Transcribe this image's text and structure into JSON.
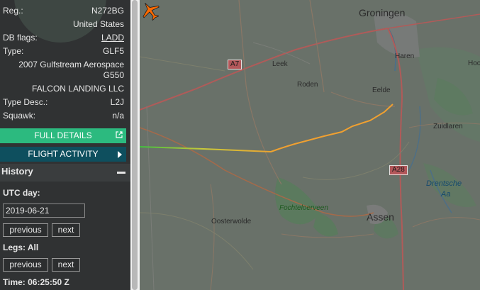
{
  "details": {
    "reg_label": "Reg.:",
    "reg_value": "N272BG",
    "country": "United States",
    "dbflags_label": "DB flags:",
    "dbflags_value": "LADD",
    "type_label": "Type:",
    "type_value": "GLF5",
    "model_line1": "2007 Gulfstream Aerospace",
    "model_line2": "G550",
    "owner": "FALCON LANDING LLC",
    "typedesc_label": "Type Desc.:",
    "typedesc_value": "L2J",
    "squawk_label": "Squawk:",
    "squawk_value": "n/a"
  },
  "buttons": {
    "full_details": "FULL DETAILS",
    "flight_activity": "FLIGHT ACTIVITY"
  },
  "history": {
    "title": "History",
    "utc_day_label": "UTC day:",
    "date_value": "2019-06-21",
    "previous_label": "previous",
    "next_label": "next",
    "legs_label": "Legs: All",
    "legs_previous": "previous",
    "legs_next": "next",
    "time_label": "Time: 06:25:50 Z"
  },
  "map": {
    "places": {
      "groningen": "Groningen",
      "haren": "Haren",
      "hoo": "Hoo",
      "leek": "Leek",
      "roden": "Roden",
      "eelde": "Eelde",
      "zuidlaren": "Zuidlaren",
      "drentsche": "Drentsche",
      "aa": "Aa",
      "fochteloerveen": "Fochteloerveen",
      "oosterwolde": "Oosterwolde",
      "assen": "Assen"
    },
    "roads": {
      "a7": "A7",
      "a28": "A28"
    },
    "icons": {
      "aircraft": "aircraft-icon",
      "external_link": "external-link-icon"
    },
    "colors": {
      "track_low": "#3fbf3f",
      "track_mid": "#c9c93a",
      "track_high": "#f0a030",
      "aircraft": "#ff6a00"
    }
  },
  "colors": {
    "full_details_bg": "#2cba7f",
    "flight_activity_bg": "#0e4f5e",
    "sidebar_bg": "#303233"
  }
}
